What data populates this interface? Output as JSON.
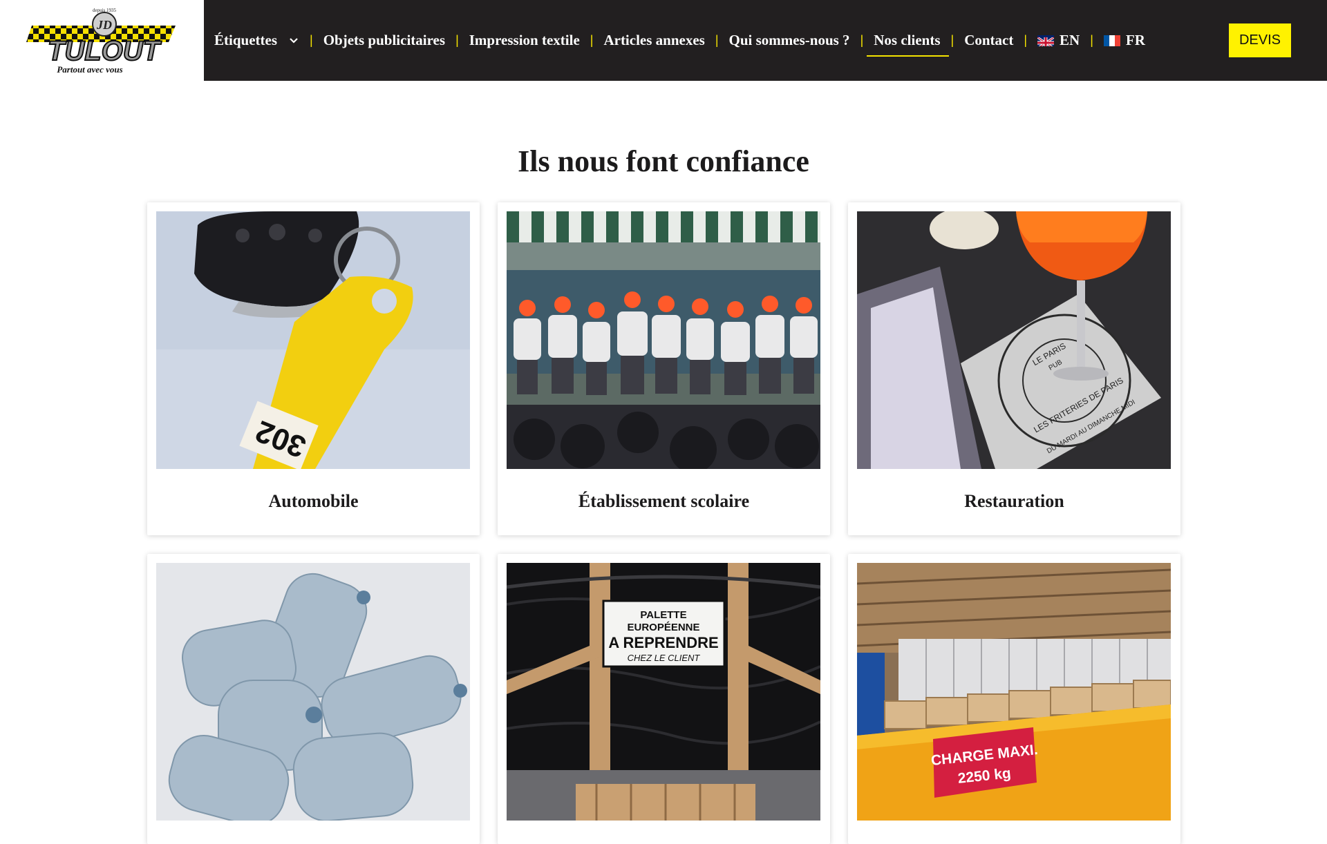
{
  "logo": {
    "brand": "TULOUT",
    "monogram": "JD",
    "tagline": "Partout avec vous",
    "since": "depuis 1935"
  },
  "nav": {
    "items": [
      {
        "label": "Étiquettes",
        "has_dropdown": true
      },
      {
        "label": "Objets publicitaires"
      },
      {
        "label": "Impression textile"
      },
      {
        "label": "Articles annexes"
      },
      {
        "label": "Qui sommes-nous ?"
      },
      {
        "label": "Nos clients",
        "active": true
      },
      {
        "label": "Contact"
      }
    ],
    "lang_en": "EN",
    "lang_fr": "FR",
    "cta": "DEVIS"
  },
  "colors": {
    "header_bg": "#221f20",
    "accent_yellow": "#fff200",
    "separator": "#f5e400"
  },
  "main": {
    "title": "Ils nous font confiance",
    "cards": [
      {
        "label": "Automobile",
        "image_text": "302"
      },
      {
        "label": "Établissement scolaire"
      },
      {
        "label": "Restauration",
        "image_text": [
          "LE PARIS",
          "PUB",
          "LES FRITERIES DE PARIS",
          "DU MARDI AU DIMANCHE MIDI"
        ]
      },
      {
        "label": ""
      },
      {
        "label": "",
        "image_text": [
          "PALETTE",
          "EUROPÉENNE",
          "A REPRENDRE",
          "CHEZ LE CLIENT"
        ]
      },
      {
        "label": "",
        "image_text": [
          "CHARGE MAXI.",
          "2250 kg"
        ]
      }
    ]
  }
}
